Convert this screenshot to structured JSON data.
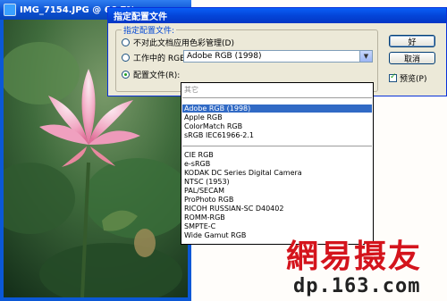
{
  "photo_window": {
    "title": "IMG_7154.JPG @ 66.7%"
  },
  "dialog": {
    "title": "指定配置文件",
    "group_label": "指定配置文件:",
    "options": [
      {
        "label": "不对此文档应用色彩管理(D)",
        "selected": false
      },
      {
        "label": "工作中的 RGB(W): sRGB IEC61966-2.1",
        "selected": false
      },
      {
        "label": "配置文件(R):",
        "selected": true
      }
    ],
    "profile_select": {
      "value": "Adobe RGB (1998)"
    },
    "buttons": {
      "ok": "好",
      "cancel": "取消"
    },
    "preview": {
      "label": "预览(P)",
      "checked": true
    }
  },
  "dropdown": {
    "top_item": "其它",
    "groups": [
      [
        "Adobe RGB (1998)",
        "Apple RGB",
        "ColorMatch RGB",
        "sRGB IEC61966-2.1"
      ],
      [
        "CIE RGB",
        "e-sRGB",
        "KODAK DC Series Digital Camera",
        "NTSC (1953)",
        "PAL/SECAM",
        "ProPhoto RGB",
        "RICOH RUSSIAN-SC D40402",
        "ROMM-RGB",
        "SMPTE-C",
        "Wide Gamut RGB"
      ]
    ],
    "selected": "Adobe RGB (1998)"
  },
  "watermark": {
    "logo": "網易摄友",
    "url": "dp.163.com"
  },
  "colors": {
    "titlebar": "#0a5ef6",
    "dialog_bg": "#ece9d8",
    "selection": "#316ac5",
    "watermark_red": "#d4141c"
  }
}
